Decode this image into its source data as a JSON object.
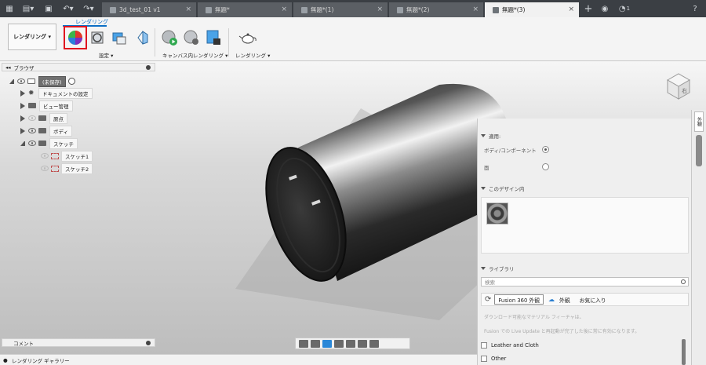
{
  "tabs": [
    {
      "label": "3d_test_01 v1",
      "active": false
    },
    {
      "label": "無題*",
      "active": false
    },
    {
      "label": "無題*(1)",
      "active": false
    },
    {
      "label": "無題*(2)",
      "active": false
    },
    {
      "label": "無題*(3)",
      "active": true
    }
  ],
  "header": {
    "notification_count": "1"
  },
  "ribbon": {
    "workspace_label": "レンダリング ▾",
    "active_tab": "レンダリング",
    "group_settings": "設定 ▾",
    "group_canvas": "キャンバス内レンダリング ▾",
    "group_render": "レンダリング ▾"
  },
  "browser": {
    "title": "ブラウザ",
    "items": [
      {
        "label": "(未保存)",
        "root": true
      },
      {
        "label": "ドキュメントの設定"
      },
      {
        "label": "ビュー管理"
      },
      {
        "label": "原点"
      },
      {
        "label": "ボディ"
      },
      {
        "label": "スケッチ"
      },
      {
        "label": "スケッチ1"
      },
      {
        "label": "スケッチ2"
      }
    ]
  },
  "comment_bar": {
    "label": "コメント"
  },
  "gallery_bar": {
    "label": "レンダリング ギャラリー"
  },
  "panel": {
    "apply_section": "適用:",
    "opt_body": "ボディ/コンポーネント",
    "opt_face": "面",
    "design_section": "このデザイン内",
    "library_section": "ライブラリ",
    "search_placeholder": "検索",
    "lib_tab_fusion": "Fusion 360 外観",
    "lib_tab_appearance": "外観",
    "lib_tab_favorites": "お気に入り",
    "info1": "ダウンロード可能なマテリアル フィーチャは、",
    "info2": "Fusion での Live Update と再起動が完了した後に常に有効になります。",
    "check1": "Leather and Cloth",
    "check2": "Other"
  },
  "side_tab": {
    "label": "外観"
  },
  "viewcube": {
    "face_right": "右"
  }
}
